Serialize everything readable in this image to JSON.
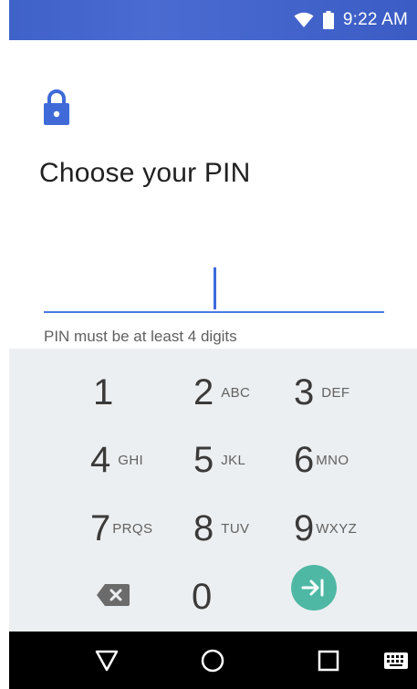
{
  "status_bar": {
    "time": "9:22 AM",
    "icons": [
      "wifi-icon",
      "battery-icon"
    ],
    "color": "#4667CD"
  },
  "screen": {
    "lock_icon": "lock-icon",
    "title": "Choose your PIN",
    "pin_value": "",
    "hint": "PIN must be at least 4 digits",
    "accent_color": "#4A7BE0"
  },
  "keypad": {
    "keys": [
      {
        "digit": "1",
        "letters": ""
      },
      {
        "digit": "2",
        "letters": "ABC"
      },
      {
        "digit": "3",
        "letters": "DEF"
      },
      {
        "digit": "4",
        "letters": "GHI"
      },
      {
        "digit": "5",
        "letters": "JKL"
      },
      {
        "digit": "6",
        "letters": "MNO"
      },
      {
        "digit": "7",
        "letters": "PRQS"
      },
      {
        "digit": "8",
        "letters": "TUV"
      },
      {
        "digit": "9",
        "letters": "WXYZ"
      },
      {
        "digit": "0",
        "letters": ""
      }
    ],
    "backspace_icon": "backspace-icon",
    "enter_icon": "enter-arrow-icon",
    "enter_color": "#4FB8A4"
  },
  "nav_bar": {
    "icons": [
      "back-triangle-icon",
      "home-circle-icon",
      "recents-square-icon",
      "keyboard-icon"
    ]
  }
}
